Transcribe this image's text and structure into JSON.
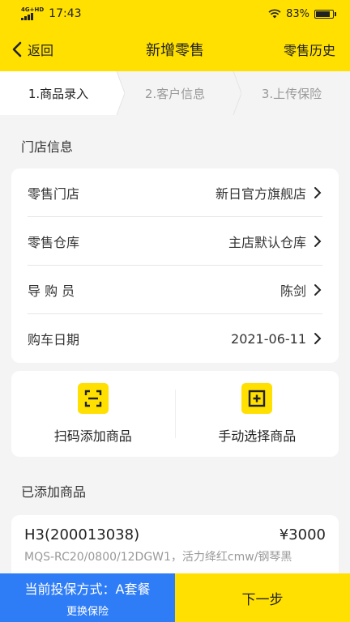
{
  "status_bar": {
    "network": "4G+HD",
    "time": "17:43",
    "battery": "83%",
    "battery_level": 0.83
  },
  "nav": {
    "back_label": "返回",
    "title": "新增零售",
    "history_label": "零售历史"
  },
  "steps": [
    {
      "label": "1.商品录入"
    },
    {
      "label": "2.客户信息"
    },
    {
      "label": "3.上传保险"
    }
  ],
  "store_section": {
    "title": "门店信息",
    "rows": [
      {
        "label": "零售门店",
        "value": "新日官方旗舰店"
      },
      {
        "label": "零售仓库",
        "value": "主店默认仓库"
      },
      {
        "label": "导 购 员",
        "value": "陈剑"
      },
      {
        "label": "购车日期",
        "value": "2021-06-11"
      }
    ]
  },
  "actions": {
    "scan_label": "扫码添加商品",
    "manual_label": "手动选择商品"
  },
  "added_section": {
    "title": "已添加商品",
    "items": [
      {
        "name": "H3(200013038)",
        "price": "¥3000",
        "desc": "MQS-RC20/0800/12DGW1，活力绛红cmw/钢琴黑"
      }
    ]
  },
  "bottom": {
    "plan_label": "当前投保方式：A套餐",
    "change_label": "更换保险",
    "next_label": "下一步"
  },
  "colors": {
    "brand_yellow": "#ffe000",
    "accent_blue": "#2f7df6"
  }
}
